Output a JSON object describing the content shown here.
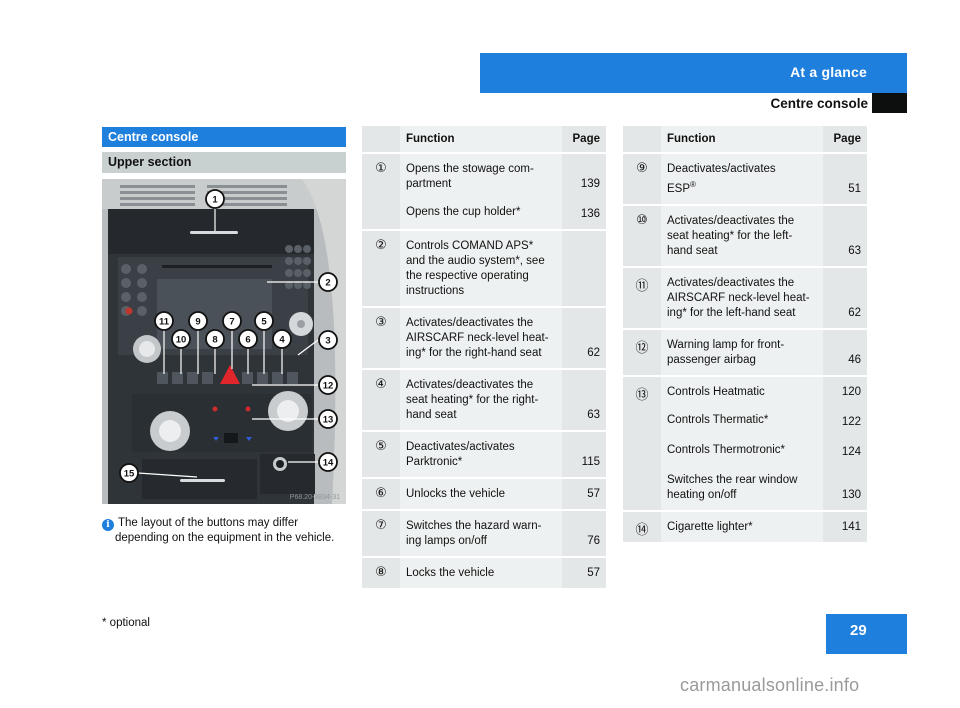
{
  "header": {
    "chapter": "At a glance",
    "section": "Centre console"
  },
  "left": {
    "section_title": "Centre console",
    "subsection_title": "Upper section",
    "photo": {
      "alt": "Centre console upper section photo with numbered callouts 1-15",
      "code": "P68.20-3834-31",
      "callouts": [
        "1",
        "2",
        "3",
        "4",
        "5",
        "6",
        "7",
        "8",
        "9",
        "10",
        "11",
        "12",
        "13",
        "14",
        "15"
      ]
    },
    "note": {
      "icon": "info-icon",
      "line1": "The layout of the buttons may differ",
      "line2": "depending on the equipment in the vehicle."
    }
  },
  "table_left": {
    "headers": {
      "number": "",
      "function": "Function",
      "page": "Page"
    },
    "rows": [
      {
        "number": "1",
        "entries": [
          {
            "lines": [
              "Opens the stowage com-",
              "partment"
            ],
            "page": "139"
          },
          {
            "lines": [
              "Opens the cup holder*"
            ],
            "page": "136"
          }
        ]
      },
      {
        "number": "2",
        "entries": [
          {
            "lines": [
              "Controls COMAND APS*",
              "and the audio system*, see",
              "the respective operating",
              "instructions"
            ],
            "page": ""
          }
        ]
      },
      {
        "number": "3",
        "entries": [
          {
            "lines": [
              "Activates/deactivates the",
              "AIRSCARF neck-level heat-",
              "ing* for the right-hand seat"
            ],
            "page": "62"
          }
        ]
      },
      {
        "number": "4",
        "entries": [
          {
            "lines": [
              "Activates/deactivates the",
              "seat heating* for the right-",
              "hand seat"
            ],
            "page": "63"
          }
        ]
      },
      {
        "number": "5",
        "entries": [
          {
            "lines": [
              "Deactivates/activates",
              "Parktronic*"
            ],
            "page": "115"
          }
        ]
      },
      {
        "number": "6",
        "entries": [
          {
            "lines": [
              "Unlocks the vehicle"
            ],
            "page": "57"
          }
        ]
      },
      {
        "number": "7",
        "entries": [
          {
            "lines": [
              "Switches the hazard warn-",
              "ing lamps on/off"
            ],
            "page": "76"
          }
        ]
      },
      {
        "number": "8",
        "entries": [
          {
            "lines": [
              "Locks the vehicle"
            ],
            "page": "57"
          }
        ]
      }
    ]
  },
  "table_right": {
    "headers": {
      "number": "",
      "function": "Function",
      "page": "Page"
    },
    "rows": [
      {
        "number": "9",
        "entries": [
          {
            "lines": [
              "Deactivates/activates",
              "ESP®"
            ],
            "page": "51"
          }
        ]
      },
      {
        "number": "10",
        "entries": [
          {
            "lines": [
              "Activates/deactivates the",
              "seat heating* for the left-",
              "hand seat"
            ],
            "page": "63"
          }
        ]
      },
      {
        "number": "11",
        "entries": [
          {
            "lines": [
              "Activates/deactivates the",
              "AIRSCARF neck-level heat-",
              "ing* for the left-hand seat"
            ],
            "page": "62"
          }
        ]
      },
      {
        "number": "12",
        "entries": [
          {
            "lines": [
              "Warning lamp for front-",
              "passenger airbag"
            ],
            "page": "46"
          }
        ]
      },
      {
        "number": "13",
        "entries": [
          {
            "lines": [
              "Controls Heatmatic"
            ],
            "page": "120"
          },
          {
            "lines": [
              "Controls Thermatic*"
            ],
            "page": "122"
          },
          {
            "lines": [
              "Controls Thermotronic*"
            ],
            "page": "124"
          },
          {
            "lines": [
              "Switches the rear window",
              "heating on/off"
            ],
            "page": "130"
          }
        ]
      },
      {
        "number": "14",
        "entries": [
          {
            "lines": [
              "Cigarette lighter*"
            ],
            "page": "141"
          }
        ]
      }
    ]
  },
  "footer": {
    "footnote": "* optional",
    "page_number": "29",
    "watermark": "carmanualsonline.info"
  },
  "colors": {
    "accent_blue": "#1e7fdd",
    "subsection_grey": "#c8d0d0",
    "table_light": "#eef1f1",
    "table_dark": "#e3e7e7",
    "header_black": "#0d0f0f",
    "watermark_grey": "#9a9a9a"
  }
}
